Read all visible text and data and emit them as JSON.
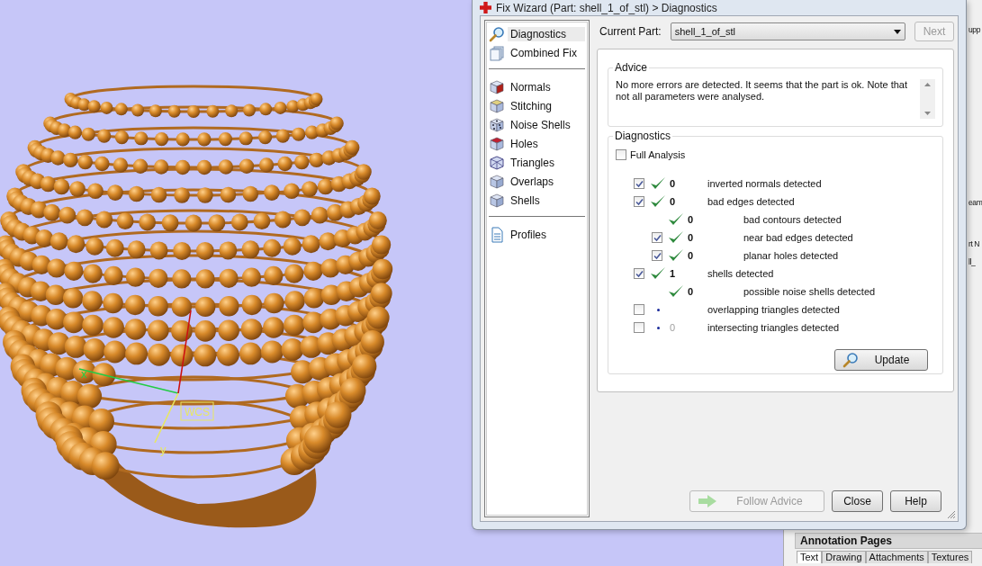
{
  "viewport": {
    "axes": [
      {
        "kind": "x",
        "label": "x"
      },
      {
        "kind": "y",
        "label": "y"
      },
      {
        "kind": "z"
      }
    ],
    "wcs_label": "WCS"
  },
  "background_panel": {
    "fragments": [
      "upp",
      "eam",
      "rt N",
      "ll_"
    ],
    "annotation": {
      "title": "Annotation Pages",
      "tabs": [
        {
          "label": "Text",
          "selected": true
        },
        {
          "label": "Drawing",
          "selected": false
        },
        {
          "label": "Attachments",
          "selected": false
        },
        {
          "label": "Textures",
          "selected": false
        }
      ]
    }
  },
  "dialog": {
    "title": "Fix Wizard (Part: shell_1_of_stl) > Diagnostics",
    "nav": {
      "sections": [
        [
          {
            "label": "Diagnostics",
            "selected": true
          },
          {
            "label": "Combined Fix",
            "selected": false
          }
        ],
        [
          {
            "label": "Normals",
            "selected": false
          },
          {
            "label": "Stitching",
            "selected": false
          },
          {
            "label": "Noise Shells",
            "selected": false
          },
          {
            "label": "Holes",
            "selected": false
          },
          {
            "label": "Triangles",
            "selected": false
          },
          {
            "label": "Overlaps",
            "selected": false
          },
          {
            "label": "Shells",
            "selected": false
          }
        ],
        [
          {
            "label": "Profiles",
            "selected": false
          }
        ]
      ]
    },
    "current_part": {
      "label": "Current Part:",
      "value": "shell_1_of_stl"
    },
    "next_button": {
      "label": "Next",
      "disabled": true
    },
    "advice": {
      "title": "Advice",
      "text": "No more errors are detected. It seems that the part is ok. Note that not all parameters were analysed."
    },
    "diagnostics": {
      "title": "Diagnostics",
      "full_analysis": {
        "label": "Full Analysis",
        "checked": false
      },
      "items": [
        {
          "checked": true,
          "kind": "passed",
          "value": "0",
          "label": "inverted normals detected"
        },
        {
          "checked": true,
          "kind": "passed",
          "value": "0",
          "label": "bad edges detected",
          "children": [
            {
              "kind": "passed",
              "value": "0",
              "label": "bad contours detected"
            },
            {
              "checked": true,
              "kind": "passed",
              "value": "0",
              "label": "near bad edges detected"
            },
            {
              "checked": true,
              "kind": "passed",
              "value": "0",
              "label": "planar holes detected"
            }
          ]
        },
        {
          "checked": true,
          "kind": "passed",
          "value": "1",
          "label": "shells detected",
          "children": [
            {
              "kind": "passed",
              "value": "0",
              "label": "possible noise shells detected"
            }
          ]
        },
        {
          "checked": false,
          "kind": "pending",
          "label": "overlapping triangles detected"
        },
        {
          "checked": false,
          "kind": "pending",
          "value": "0",
          "label": "intersecting triangles detected"
        }
      ]
    },
    "update_button": {
      "label": "Update"
    },
    "footer_buttons": [
      {
        "kind": "with-icon",
        "label": "Follow Advice",
        "disabled": true
      },
      {
        "kind": "plain",
        "label": "Close",
        "disabled": false
      },
      {
        "kind": "plain",
        "label": "Help",
        "disabled": false
      }
    ]
  }
}
